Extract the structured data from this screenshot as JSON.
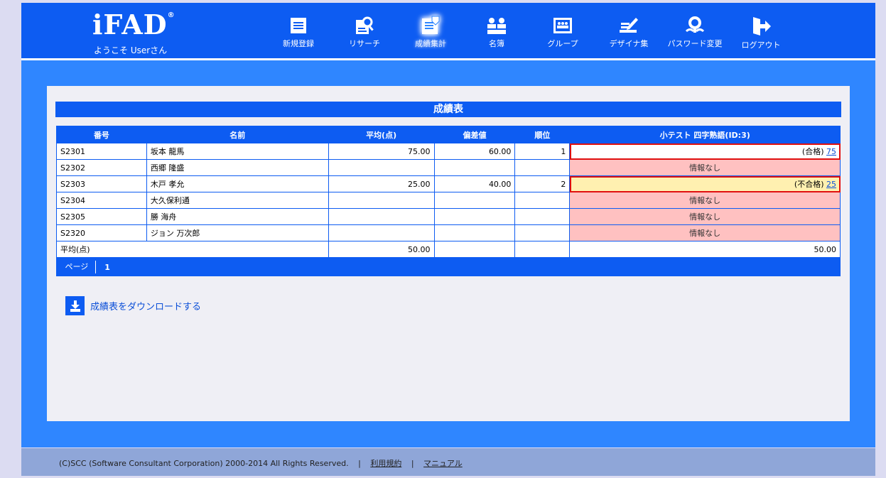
{
  "header": {
    "logo": "iFAD",
    "logo_mark": "®",
    "welcome": "ようこそ Userさん",
    "nav": [
      {
        "label": "新規登録",
        "icon": "register-icon"
      },
      {
        "label": "リサーチ",
        "icon": "research-icon"
      },
      {
        "label": "成績集計",
        "icon": "grades-icon",
        "active": true
      },
      {
        "label": "名簿",
        "icon": "roster-icon"
      },
      {
        "label": "グループ",
        "icon": "group-icon"
      },
      {
        "label": "デザイナ集",
        "icon": "designer-icon"
      },
      {
        "label": "パスワード変更",
        "icon": "password-icon"
      },
      {
        "label": "ログアウト",
        "icon": "logout-icon"
      }
    ]
  },
  "main": {
    "title": "成績表",
    "columns": [
      "番号",
      "名前",
      "平均(点)",
      "偏差値",
      "順位",
      "小テスト 四字熟語(ID:3)"
    ],
    "rows": [
      {
        "id": "S2301",
        "name": "坂本 龍馬",
        "avg": "75.00",
        "dev": "60.00",
        "rank": "1",
        "quiz_status": "(合格)",
        "quiz_score": "75"
      },
      {
        "id": "S2302",
        "name": "西郷 隆盛",
        "avg": "",
        "dev": "",
        "rank": "",
        "quiz_text": "情報なし"
      },
      {
        "id": "S2303",
        "name": "木戸 孝允",
        "avg": "25.00",
        "dev": "40.00",
        "rank": "2",
        "quiz_status": "(不合格)",
        "quiz_score": "25"
      },
      {
        "id": "S2304",
        "name": "大久保利通",
        "avg": "",
        "dev": "",
        "rank": "",
        "quiz_text": "情報なし"
      },
      {
        "id": "S2305",
        "name": "勝 海舟",
        "avg": "",
        "dev": "",
        "rank": "",
        "quiz_text": "情報なし"
      },
      {
        "id": "S2320",
        "name": "ジョン 万次郎",
        "avg": "",
        "dev": "",
        "rank": "",
        "quiz_text": "情報なし"
      }
    ],
    "average_row": {
      "label": "平均(点)",
      "avg": "50.00",
      "dev": "",
      "rank": "",
      "quiz": "50.00"
    },
    "pager": {
      "label": "ページ",
      "pages": [
        "1"
      ]
    },
    "download": "成績表をダウンロードする"
  },
  "footer": {
    "copyright": "(C)SCC (Software Consultant Corporation) 2000-2014 All Rights Reserved.",
    "links": [
      "利用規約",
      "マニュアル"
    ]
  },
  "colors": {
    "header": "#0d5cf2",
    "band": "#2f86ff",
    "noinfo": "#ffc1c1",
    "fail_highlight": "#fff0b0",
    "outline": "#e01010"
  }
}
